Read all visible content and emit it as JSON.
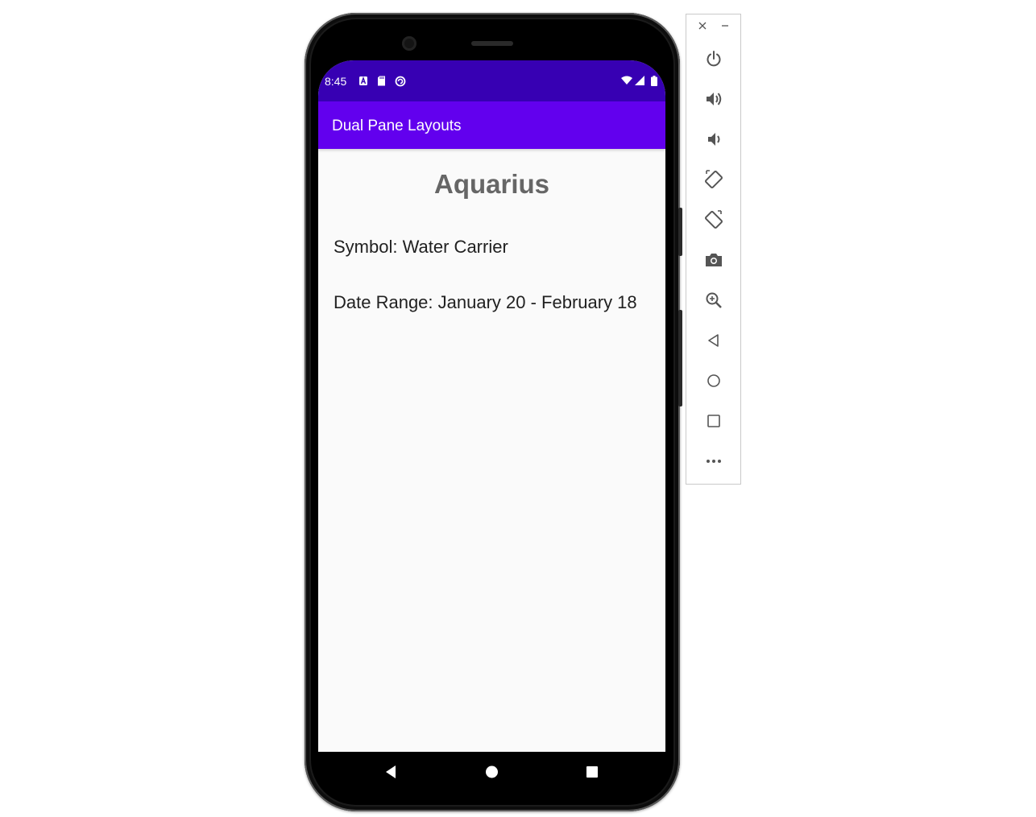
{
  "status_bar": {
    "time": "8:45",
    "notification_icons": [
      "accessibility-icon",
      "sd-card-icon",
      "sync-icon"
    ],
    "right_icons": [
      "wifi-icon",
      "signal-icon",
      "battery-icon"
    ]
  },
  "app_bar": {
    "title": "Dual Pane Layouts"
  },
  "detail": {
    "title": "Aquarius",
    "symbol": "Symbol: Water Carrier",
    "date_range": "Date Range: January 20 - February 18"
  },
  "nav_bar": {
    "buttons": [
      "back-icon",
      "home-icon",
      "recents-icon"
    ]
  },
  "emulator_toolbar": {
    "window_controls": [
      "close-icon",
      "minimize-icon"
    ],
    "buttons": [
      "power",
      "volume-up",
      "volume-down",
      "rotate-left",
      "rotate-right",
      "screenshot",
      "zoom",
      "back",
      "home",
      "overview",
      "more"
    ]
  },
  "colors": {
    "status_bar": "#3700b3",
    "app_bar": "#6200ee",
    "screen_bg": "#fafafa",
    "title_text": "#666666",
    "body_text": "#212121"
  }
}
